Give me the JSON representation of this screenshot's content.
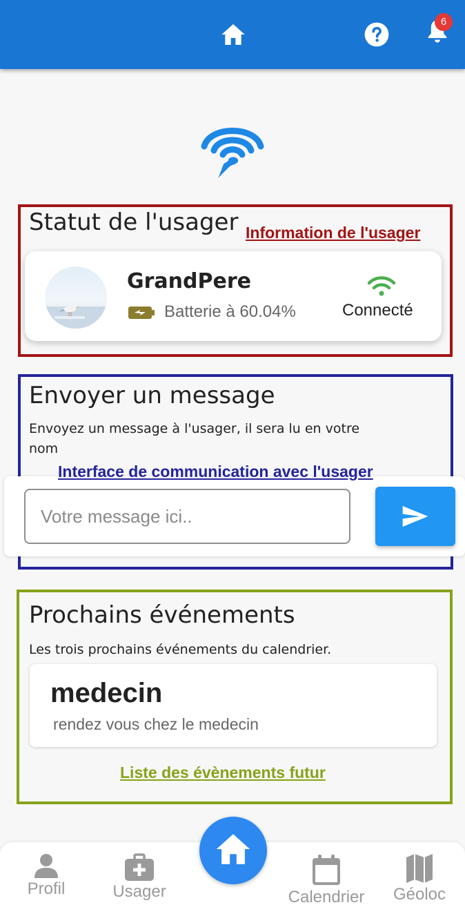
{
  "header": {
    "notification_count": "6",
    "color": "#1976d2"
  },
  "status": {
    "title": "Statut de l'usager",
    "annotation": "Information de l'usager",
    "user_name": "GrandPere",
    "battery": "Batterie à 60.04%",
    "connection": "Connecté"
  },
  "message": {
    "title": "Envoyer un message",
    "description_line1": "Envoyez un message à l'usager, il sera lu en votre",
    "description_line2": "nom",
    "annotation": "Interface de communication avec l'usager",
    "placeholder": "Votre message ici.."
  },
  "events": {
    "title": "Prochains événements",
    "description": "Les trois prochains événements du calendrier.",
    "items": [
      {
        "title": "medecin",
        "description": "rendez vous chez le medecin"
      }
    ],
    "annotation": "Liste des évènements futur"
  },
  "nav": {
    "items": [
      {
        "label": "Profil",
        "icon": "person-icon"
      },
      {
        "label": "Usager",
        "icon": "medkit-icon"
      },
      {
        "label": "Calendrier",
        "icon": "calendar-icon"
      },
      {
        "label": "Géoloc",
        "icon": "map-icon"
      }
    ],
    "center_icon": "home-icon"
  },
  "colors": {
    "accent": "#2196f3",
    "status_online": "#4caf50",
    "annot_red": "#a31414",
    "annot_blue": "#24249c",
    "annot_green": "#86a31a"
  }
}
